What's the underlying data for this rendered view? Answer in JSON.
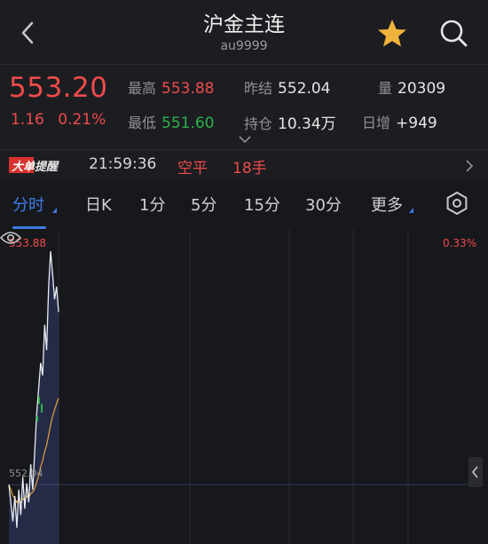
{
  "header": {
    "title": "沪金主连",
    "code": "au9999"
  },
  "quote": {
    "price": "553.20",
    "change": "1.16",
    "change_pct": "0.21%",
    "stats": [
      {
        "label": "最高",
        "value": "553.88",
        "color": "red"
      },
      {
        "label": "昨结",
        "value": "552.04",
        "color": "neutral"
      },
      {
        "label": "量",
        "value": "20309",
        "color": "neutral"
      },
      {
        "label": "最低",
        "value": "551.60",
        "color": "green"
      },
      {
        "label": "持仓",
        "value": "10.34万",
        "color": "neutral"
      },
      {
        "label": "日增",
        "value": "+949",
        "color": "neutral"
      }
    ]
  },
  "alert": {
    "tag_part1": "大单",
    "tag_part2": "提醒",
    "time": "21:59:36",
    "type": "空平",
    "qty": "18手"
  },
  "tabs": [
    {
      "label": "分时",
      "active": true
    },
    {
      "label": "日K",
      "active": false
    },
    {
      "label": "1分",
      "active": false
    },
    {
      "label": "5分",
      "active": false
    },
    {
      "label": "15分",
      "active": false
    },
    {
      "label": "30分",
      "active": false
    },
    {
      "label": "更多",
      "active": false
    }
  ],
  "chart": {
    "high_label": "553.88",
    "pct_label": "0.33%",
    "base_label": "552.04"
  },
  "colors": {
    "up": "#ef4b4b",
    "down": "#2bb24c",
    "accent": "#3d7be4",
    "star": "#f0b43c"
  },
  "chart_data": {
    "type": "line",
    "series": [
      {
        "values": [
          552.04,
          551.9,
          551.75,
          551.95,
          551.7,
          552.0,
          551.8,
          552.1,
          551.85,
          552.05,
          551.9,
          552.2,
          552.0,
          552.3,
          552.6,
          552.8,
          553.0,
          552.9,
          553.3,
          553.1,
          553.6,
          553.88,
          553.7,
          553.5,
          553.6,
          553.4
        ]
      },
      {
        "values": [
          552.04,
          552.0,
          551.95,
          551.93,
          551.9,
          551.92,
          551.9,
          551.93,
          551.92,
          551.95,
          551.94,
          551.97,
          551.98,
          552.01,
          552.06,
          552.11,
          552.18,
          552.23,
          552.3,
          552.35,
          552.43,
          552.51,
          552.58,
          552.63,
          552.68,
          552.72
        ]
      }
    ],
    "ylim": [
      551.6,
      553.88
    ]
  }
}
